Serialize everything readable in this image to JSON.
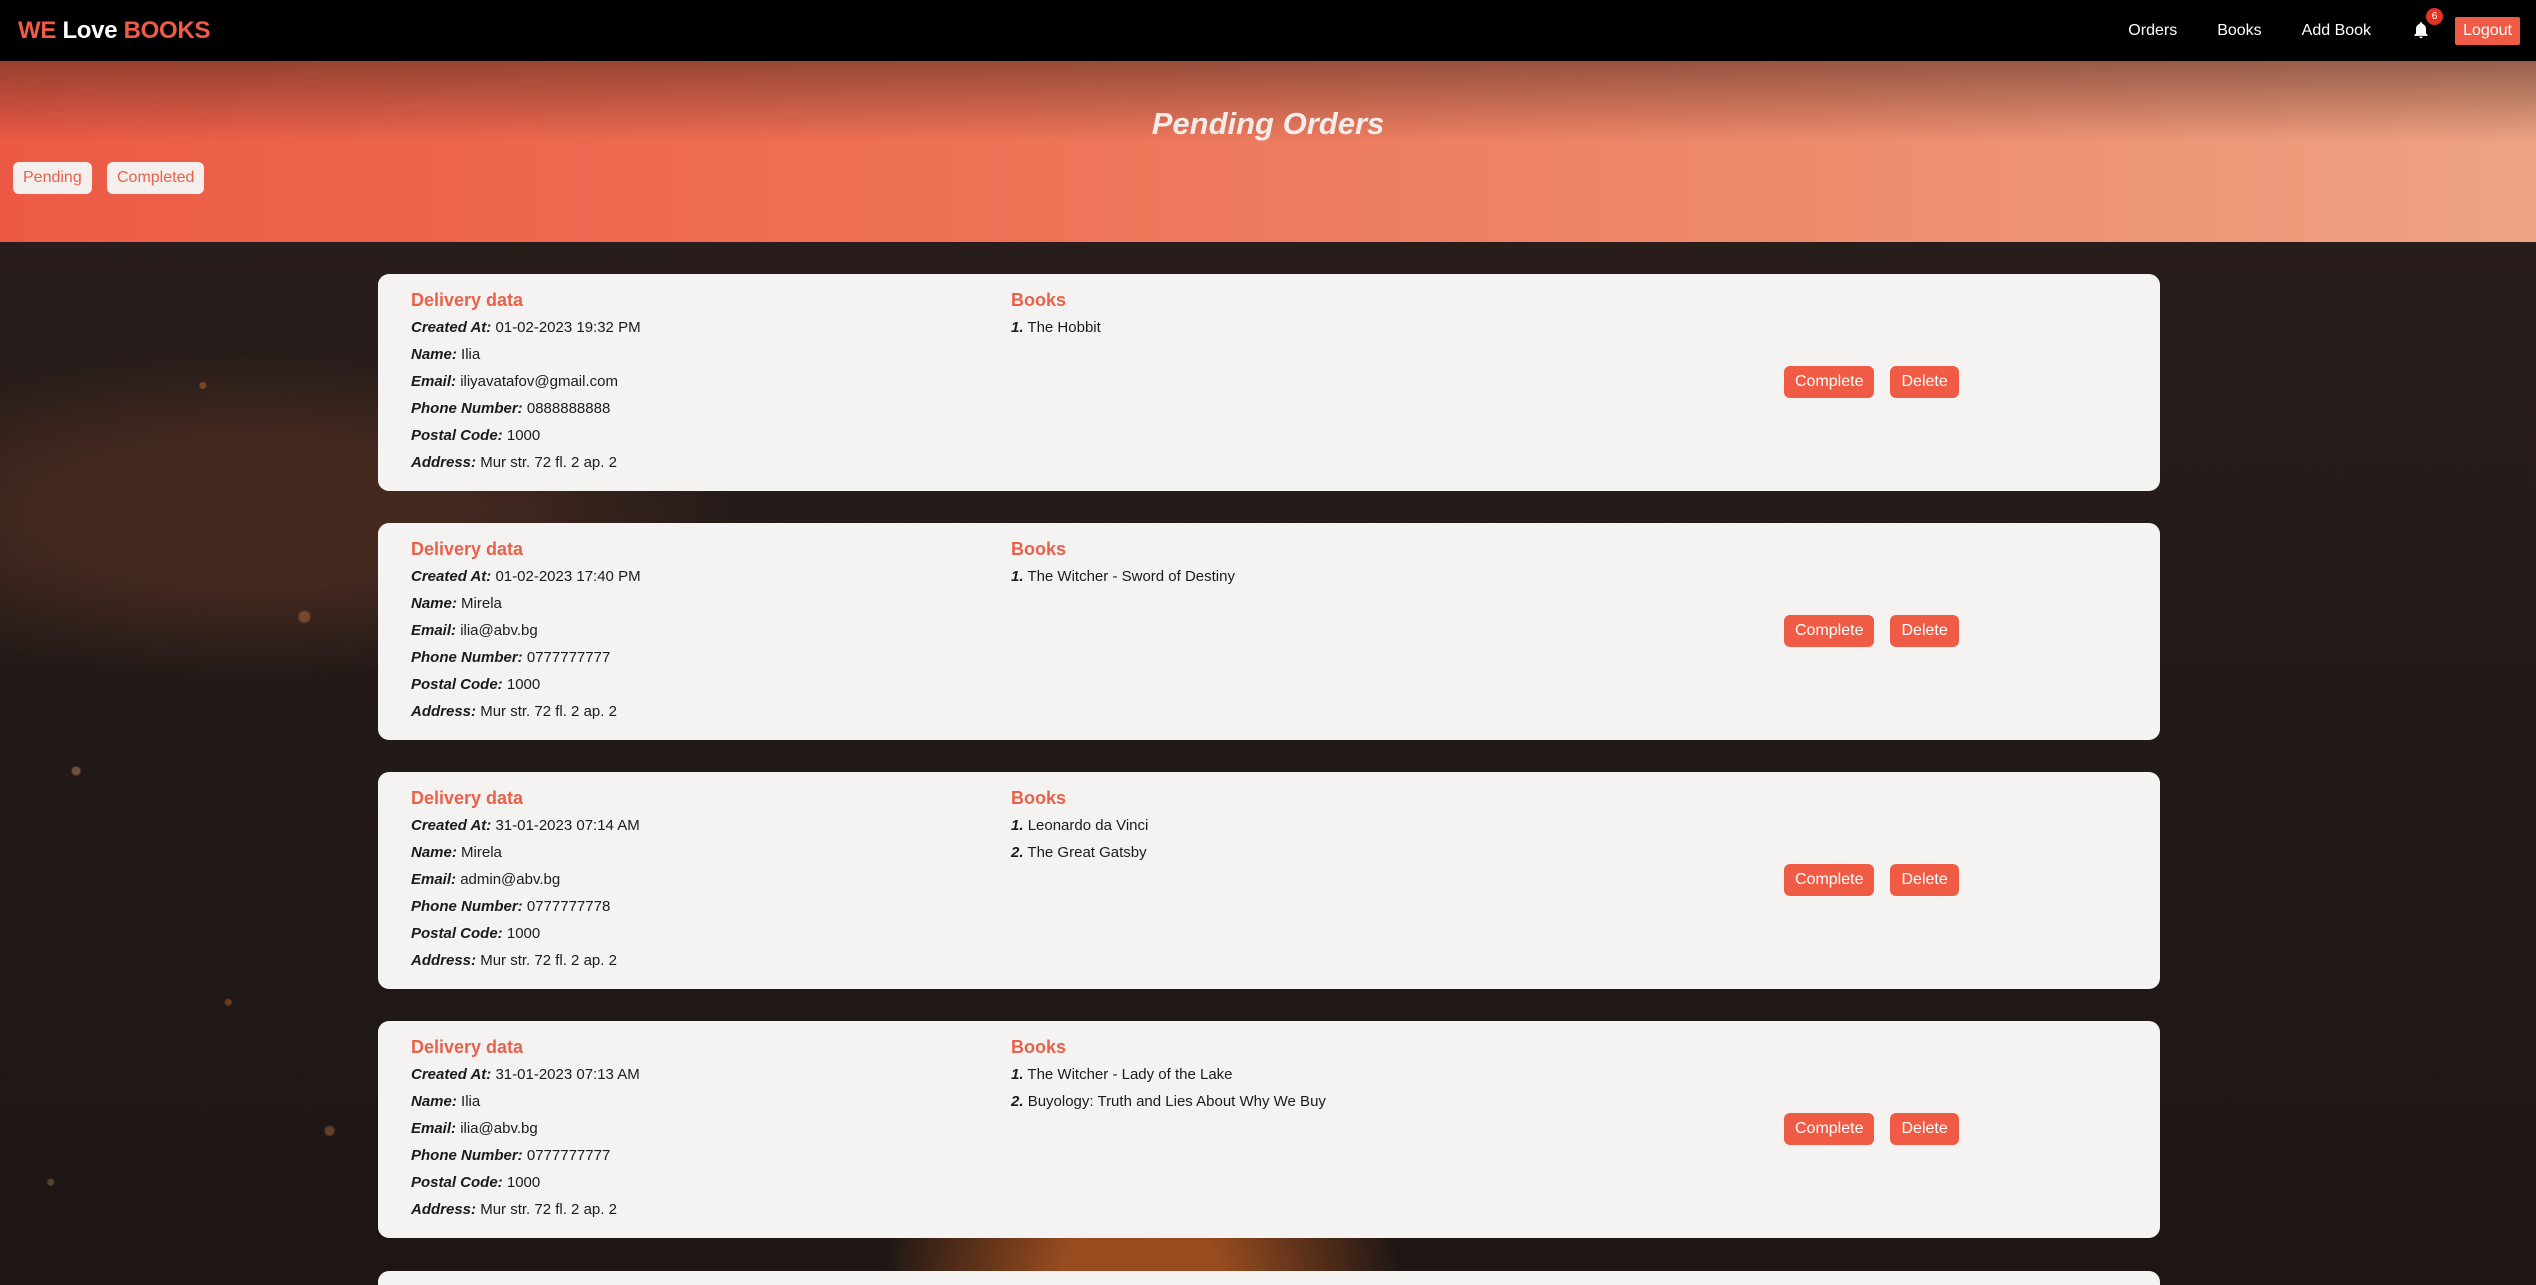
{
  "brand": {
    "we": "WE",
    "love": "Love",
    "books": "BOOKS"
  },
  "nav": {
    "orders": "Orders",
    "books": "Books",
    "add_book": "Add Book",
    "notification_count": "6",
    "logout": "Logout"
  },
  "hero": {
    "title": "Pending Orders",
    "filters": {
      "pending": "Pending",
      "completed": "Completed"
    }
  },
  "labels": {
    "delivery_title": "Delivery data",
    "books_title": "Books",
    "created_at": "Created At:",
    "name": "Name:",
    "email": "Email:",
    "phone": "Phone Number:",
    "postal": "Postal Code:",
    "address": "Address:",
    "complete": "Complete",
    "delete": "Delete"
  },
  "orders": [
    {
      "created_at": "01-02-2023 19:32 PM",
      "name": "Ilia",
      "email": "iliyavatafov@gmail.com",
      "phone": "0888888888",
      "postal": "1000",
      "address": "Mur str. 72 fl. 2 ap. 2",
      "books": [
        {
          "num": "1.",
          "title": "The Hobbit"
        }
      ]
    },
    {
      "created_at": "01-02-2023 17:40 PM",
      "name": "Mirela",
      "email": "ilia@abv.bg",
      "phone": "0777777777",
      "postal": "1000",
      "address": "Mur str. 72 fl. 2 ap. 2",
      "books": [
        {
          "num": "1.",
          "title": "The Witcher - Sword of Destiny"
        }
      ]
    },
    {
      "created_at": "31-01-2023 07:14 AM",
      "name": "Mirela",
      "email": "admin@abv.bg",
      "phone": "0777777778",
      "postal": "1000",
      "address": "Mur str. 72 fl. 2 ap. 2",
      "books": [
        {
          "num": "1.",
          "title": "Leonardo da Vinci"
        },
        {
          "num": "2.",
          "title": "The Great Gatsby"
        }
      ]
    },
    {
      "created_at": "31-01-2023 07:13 AM",
      "name": "Ilia",
      "email": "ilia@abv.bg",
      "phone": "0777777777",
      "postal": "1000",
      "address": "Mur str. 72 fl. 2 ap. 2",
      "books": [
        {
          "num": "1.",
          "title": "The Witcher - Lady of the Lake"
        },
        {
          "num": "2.",
          "title": "Buyology: Truth and Lies About Why We Buy"
        }
      ]
    }
  ]
}
